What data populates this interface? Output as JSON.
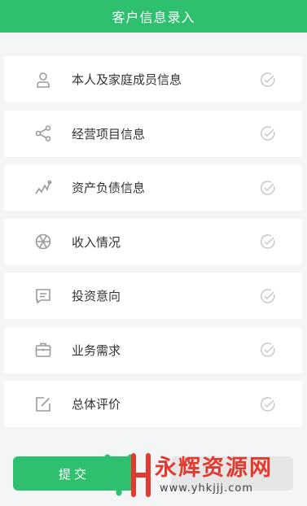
{
  "header": {
    "title": "客户信息录入"
  },
  "menu": {
    "items": [
      {
        "label": "本人及家庭成员信息",
        "icon": "person-icon"
      },
      {
        "label": "经营项目信息",
        "icon": "share-icon"
      },
      {
        "label": "资产负债信息",
        "icon": "trend-icon"
      },
      {
        "label": "收入情况",
        "icon": "aperture-icon"
      },
      {
        "label": "投资意向",
        "icon": "message-icon"
      },
      {
        "label": "业务需求",
        "icon": "briefcase-icon"
      },
      {
        "label": "总体评价",
        "icon": "edit-icon"
      }
    ],
    "check_icon": "check-circle-icon"
  },
  "footer": {
    "submit_label": "提交"
  },
  "watermark": {
    "title": "永辉资源网",
    "url": "www.yhkjjj.com"
  },
  "colors": {
    "accent": "#2fc06f",
    "icon": "#9a9a9a",
    "check": "#c8c8c8",
    "watermark": "#e23a2f"
  }
}
